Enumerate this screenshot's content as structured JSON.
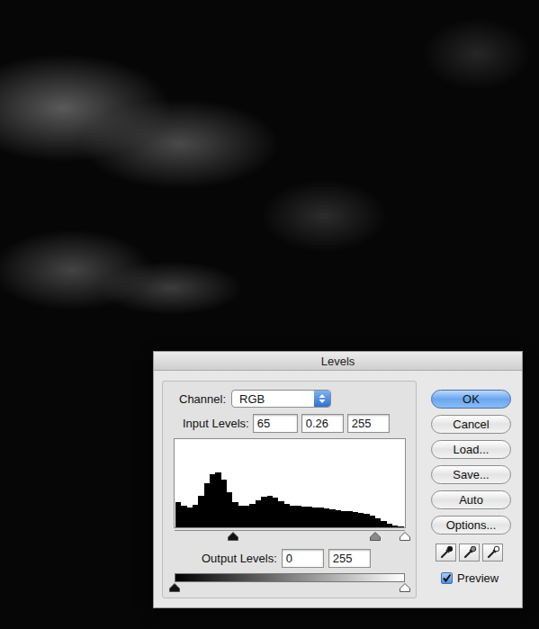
{
  "window": {
    "title": "Levels"
  },
  "channel": {
    "label": "Channel:",
    "value": "RGB"
  },
  "input_levels": {
    "label": "Input Levels:",
    "values": [
      "65",
      "0.26",
      "255"
    ]
  },
  "histogram": {
    "values": [
      29,
      24,
      22,
      26,
      36,
      50,
      60,
      62,
      54,
      40,
      29,
      24,
      24,
      27,
      31,
      35,
      36,
      34,
      30,
      27,
      25,
      24,
      23,
      23,
      22,
      22,
      21,
      20,
      19,
      18,
      18,
      17,
      16,
      15,
      13,
      10,
      7,
      4,
      2,
      1
    ]
  },
  "input_slider": [
    {
      "kind": "black",
      "level": 0.255
    },
    {
      "kind": "gray",
      "level": 0.87
    },
    {
      "kind": "white",
      "level": 1
    }
  ],
  "output_levels": {
    "label": "Output Levels:",
    "values": [
      "0",
      "255"
    ]
  },
  "output_slider": [
    {
      "kind": "black",
      "level": 0
    },
    {
      "kind": "white",
      "level": 1
    }
  ],
  "buttons": [
    {
      "label": "OK",
      "default": true
    },
    {
      "label": "Cancel",
      "default": false
    },
    {
      "label": "Load...",
      "default": false
    },
    {
      "label": "Save...",
      "default": false
    },
    {
      "label": "Auto",
      "default": false
    },
    {
      "label": "Options...",
      "default": false
    }
  ],
  "eyedroppers": [
    {
      "kind": "black"
    },
    {
      "kind": "gray"
    },
    {
      "kind": "white"
    }
  ],
  "preview": {
    "label": "Preview",
    "checked": true
  }
}
